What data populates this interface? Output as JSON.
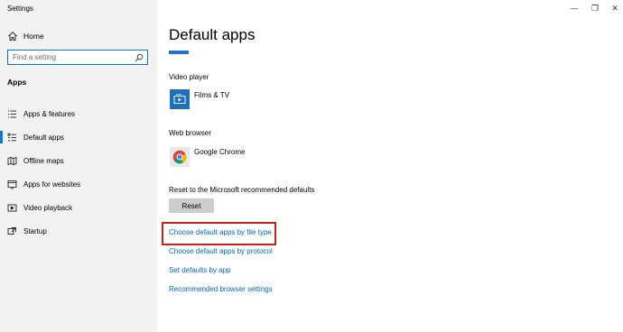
{
  "window": {
    "title": "Settings",
    "controls": [
      "—",
      "❐",
      "✕"
    ]
  },
  "sidebar": {
    "home_label": "Home",
    "search_placeholder": "Find a setting",
    "section_label": "Apps",
    "items": [
      {
        "label": "Apps & features",
        "icon": "list-icon",
        "active": false
      },
      {
        "label": "Default apps",
        "icon": "default-apps-icon",
        "active": true
      },
      {
        "label": "Offline maps",
        "icon": "map-icon",
        "active": false
      },
      {
        "label": "Apps for websites",
        "icon": "web-apps-icon",
        "active": false
      },
      {
        "label": "Video playback",
        "icon": "video-icon",
        "active": false
      },
      {
        "label": "Startup",
        "icon": "startup-icon",
        "active": false
      }
    ]
  },
  "main": {
    "title": "Default apps",
    "video_player": {
      "label": "Video player",
      "app": "Films & TV"
    },
    "web_browser": {
      "label": "Web browser",
      "app": "Google Chrome"
    },
    "reset": {
      "label": "Reset to the Microsoft recommended defaults",
      "button": "Reset"
    },
    "links": [
      "Choose default apps by file type",
      "Choose default apps by protocol",
      "Set defaults by app",
      "Recommended browser settings"
    ]
  },
  "colors": {
    "accent": "#0078d7",
    "link": "#0067b8",
    "highlight": "#c8211f",
    "sidebar_bg": "#f2f2f2"
  }
}
